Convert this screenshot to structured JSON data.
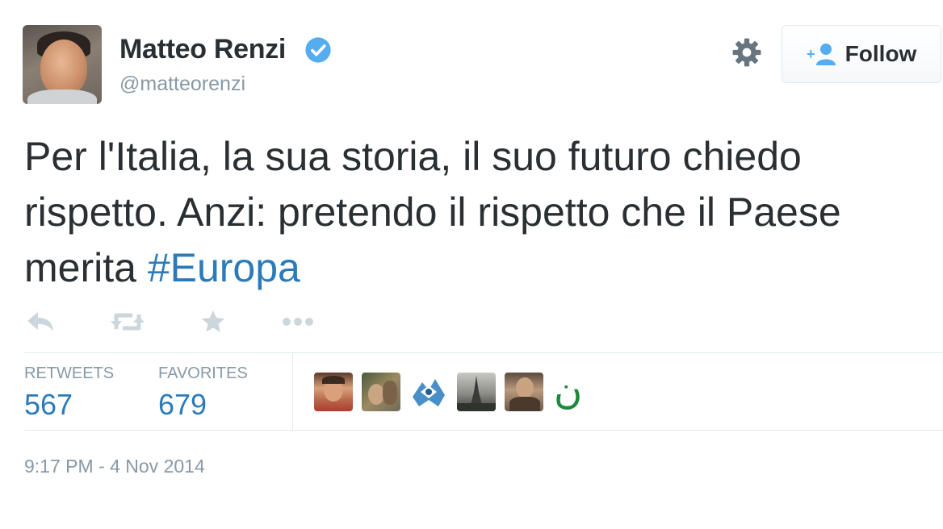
{
  "user": {
    "name": "Matteo Renzi",
    "handle": "@matteorenzi",
    "verified": true,
    "avatar_icon": "profile-photo"
  },
  "header": {
    "settings_icon": "gear-icon",
    "follow_label": "Follow",
    "follow_icon": "add-user-icon"
  },
  "tweet": {
    "text_before": "Per l'Italia, la sua storia, il suo futuro chiedo rispetto. Anzi: pretendo il rispetto che il Paese merita ",
    "hashtag": "#Europa"
  },
  "actions": [
    {
      "name": "reply",
      "icon": "reply-icon"
    },
    {
      "name": "retweet",
      "icon": "retweet-icon"
    },
    {
      "name": "favorite",
      "icon": "star-icon"
    },
    {
      "name": "more",
      "icon": "more-icon"
    }
  ],
  "stats": {
    "retweets_label": "RETWEETS",
    "retweets_count": "567",
    "favorites_label": "FAVORITES",
    "favorites_count": "679"
  },
  "favoriters": {
    "thumbnails": [
      "avatar-1",
      "avatar-2",
      "avatar-3",
      "avatar-4",
      "avatar-5"
    ],
    "last_glyph": "ن"
  },
  "timestamp": "9:17 PM - 4 Nov 2014",
  "colors": {
    "link": "#2b7bb9",
    "muted": "#8899a6",
    "text": "#292f33",
    "verified": "#55acee",
    "action_icon": "#ccd6dd"
  }
}
